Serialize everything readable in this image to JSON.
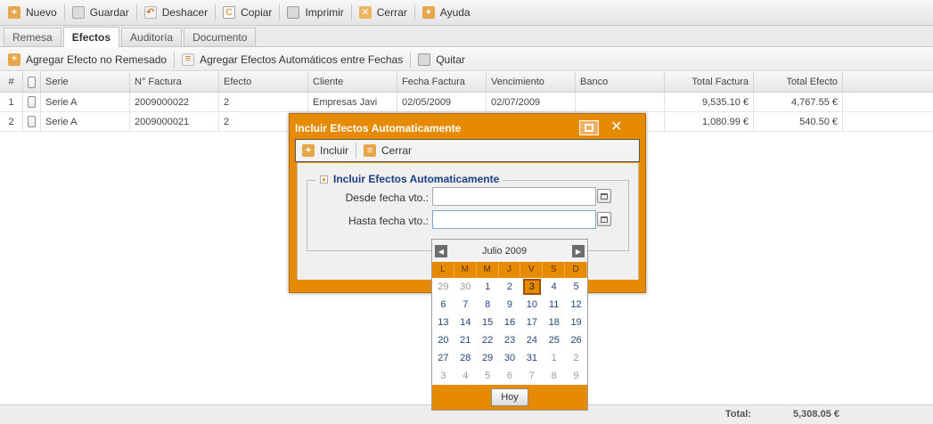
{
  "toolbar": {
    "nuevo": "Nuevo",
    "guardar": "Guardar",
    "deshacer": "Deshacer",
    "copiar": "Copiar",
    "imprimir": "Imprimir",
    "cerrar": "Cerrar",
    "ayuda": "Ayuda"
  },
  "tabs": [
    "Remesa",
    "Efectos",
    "Auditoría",
    "Documento"
  ],
  "active_tab": "Efectos",
  "subtoolbar": {
    "agregar_no_remesado": "Agregar Efecto no Remesado",
    "agregar_automaticos": "Agregar Efectos Automáticos entre Fechas",
    "quitar": "Quitar"
  },
  "grid": {
    "headers": {
      "num": "#",
      "serie": "Serie",
      "factura": "N° Factura",
      "efecto": "Efecto",
      "cliente": "Cliente",
      "fecha": "Fecha Factura",
      "vencimiento": "Vencimiento",
      "banco": "Banco",
      "total_factura": "Total Factura",
      "total_efecto": "Total Efecto"
    },
    "rows": [
      {
        "num": "1",
        "serie": "Serie A",
        "factura": "2009000022",
        "efecto": "2",
        "cliente": "Empresas Javi",
        "fecha": "02/05/2009",
        "vencimiento": "02/07/2009",
        "banco": "",
        "total_factura": "9,535.10 €",
        "total_efecto": "4,767.55 €"
      },
      {
        "num": "2",
        "serie": "Serie A",
        "factura": "2009000021",
        "efecto": "2",
        "cliente": "",
        "fecha": "",
        "vencimiento": "",
        "banco": "",
        "total_factura": "1,080.99 €",
        "total_efecto": "540.50 €"
      }
    ]
  },
  "footer": {
    "total_label": "Total:",
    "total_value": "5,308.05 €"
  },
  "dialog": {
    "title": "Incluir Efectos Automaticamente",
    "incluir": "Incluir",
    "cerrar": "Cerrar",
    "legend": "Incluir Efectos Automaticamente",
    "desde_label": "Desde fecha vto.:",
    "hasta_label": "Hasta fecha vto.:",
    "desde_value": "",
    "hasta_value": ""
  },
  "calendar": {
    "month_label": "Julio 2009",
    "weekdays": [
      "L",
      "M",
      "M",
      "J",
      "V",
      "S",
      "D"
    ],
    "days": [
      [
        "29",
        "30",
        "1",
        "2",
        "3",
        "4",
        "5"
      ],
      [
        "6",
        "7",
        "8",
        "9",
        "10",
        "11",
        "12"
      ],
      [
        "13",
        "14",
        "15",
        "16",
        "17",
        "18",
        "19"
      ],
      [
        "20",
        "21",
        "22",
        "23",
        "24",
        "25",
        "26"
      ],
      [
        "27",
        "28",
        "29",
        "30",
        "31",
        "1",
        "2"
      ],
      [
        "3",
        "4",
        "5",
        "6",
        "7",
        "8",
        "9"
      ]
    ],
    "today": "3",
    "today_button": "Hoy"
  },
  "colors": {
    "accent": "#e68a00",
    "link": "#23467d",
    "legend": "#1b3f84"
  }
}
